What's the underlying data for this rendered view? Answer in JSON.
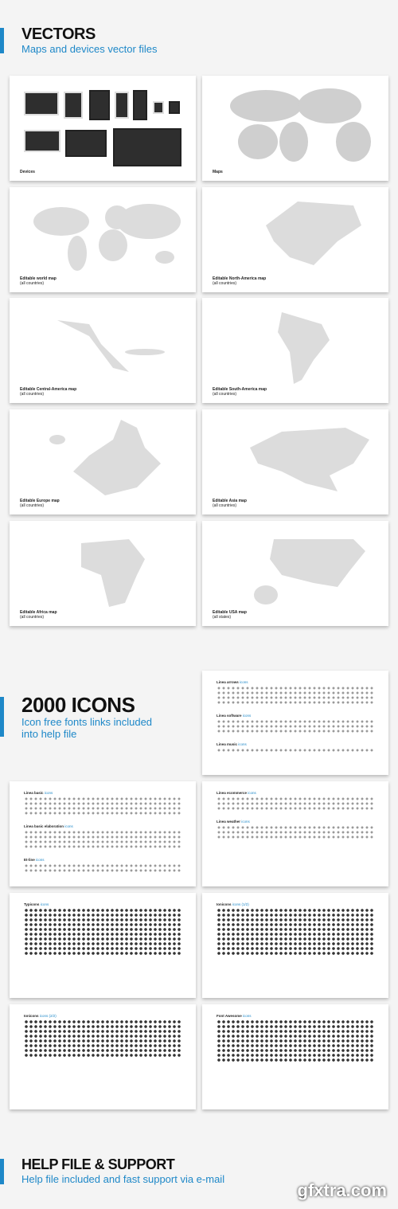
{
  "vectors": {
    "title": "VECTORS",
    "subtitle": "Maps and devices vector files"
  },
  "vector_cards": [
    {
      "bold": "Devices",
      "rest": ""
    },
    {
      "bold": "Maps",
      "rest": ""
    },
    {
      "bold": "Editable world map",
      "rest": " (all countries)"
    },
    {
      "bold": "Editable North-America map",
      "rest": "(all countries)"
    },
    {
      "bold": "Editable Central-America map",
      "rest": "(all countries)"
    },
    {
      "bold": "Editable South-America map",
      "rest": "(all countries)"
    },
    {
      "bold": "Editable Europe map",
      "rest": "(all countries)"
    },
    {
      "bold": "Editable Asia map",
      "rest": "(all countries)"
    },
    {
      "bold": "Editable Africa map",
      "rest": "(all countries)"
    },
    {
      "bold": "Editable USA map",
      "rest": "(all states)"
    }
  ],
  "icons": {
    "title": "2000 ICONS",
    "subtitle_line1": "Icon free fonts links included",
    "subtitle_line2": "into help file"
  },
  "icon_sets": [
    {
      "name": "Linea arrows",
      "suffix": "icons"
    },
    {
      "name": "Linea software",
      "suffix": "icons"
    },
    {
      "name": "Linea music",
      "suffix": "icons"
    },
    {
      "name": "Linea basic",
      "suffix": "icons"
    },
    {
      "name": "Linea basic elaboration",
      "suffix": "icons"
    },
    {
      "name": "Et-line",
      "suffix": "icons"
    },
    {
      "name": "Linea ecommerce",
      "suffix": "icons"
    },
    {
      "name": "Linea weather",
      "suffix": "icons"
    },
    {
      "name": "Typicons",
      "suffix": "icons"
    },
    {
      "name": "Ionicons",
      "suffix": "icons (1/2)"
    },
    {
      "name": "Ionicons",
      "suffix": "icons (2/2)"
    },
    {
      "name": "Font Awesome",
      "suffix": "icons"
    }
  ],
  "help": {
    "title": "HELP FILE & SUPPORT",
    "subtitle": "Help file included and fast support via e-mail"
  },
  "watermark": "gfxtra.com",
  "colors": {
    "accent": "#1e88c8",
    "map_gray": "#dcdcdc",
    "device_screen": "#2e2e2e"
  }
}
